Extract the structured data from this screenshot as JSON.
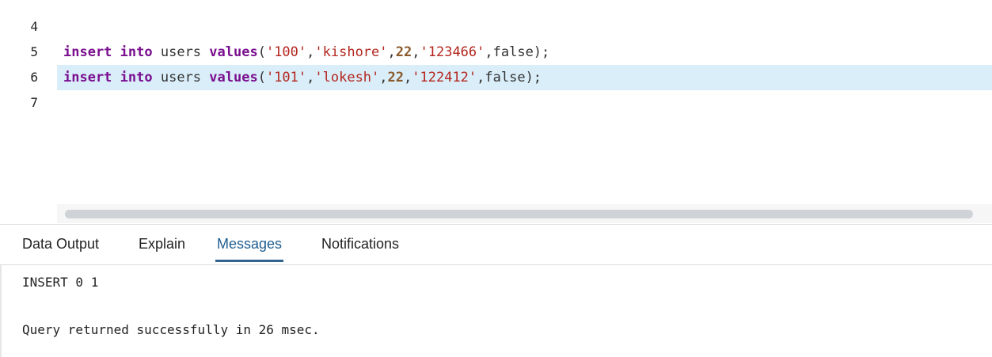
{
  "editor": {
    "lines": [
      {
        "number": "4",
        "tokens": []
      },
      {
        "number": "5",
        "tokens": [
          {
            "t": "kw",
            "v": "insert"
          },
          {
            "t": "plain",
            "v": " "
          },
          {
            "t": "kw",
            "v": "into"
          },
          {
            "t": "plain",
            "v": " users "
          },
          {
            "t": "kw",
            "v": "values"
          },
          {
            "t": "plain",
            "v": "("
          },
          {
            "t": "str",
            "v": "'100'"
          },
          {
            "t": "plain",
            "v": ","
          },
          {
            "t": "str",
            "v": "'kishore'"
          },
          {
            "t": "plain",
            "v": ","
          },
          {
            "t": "num",
            "v": "22"
          },
          {
            "t": "plain",
            "v": ","
          },
          {
            "t": "str",
            "v": "'123466'"
          },
          {
            "t": "plain",
            "v": ",false);"
          }
        ]
      },
      {
        "number": "6",
        "active": true,
        "tokens": [
          {
            "t": "kw",
            "v": "insert"
          },
          {
            "t": "plain",
            "v": " "
          },
          {
            "t": "kw",
            "v": "into"
          },
          {
            "t": "plain",
            "v": " users "
          },
          {
            "t": "kw",
            "v": "values"
          },
          {
            "t": "plain",
            "v": "("
          },
          {
            "t": "str",
            "v": "'101'"
          },
          {
            "t": "plain",
            "v": ","
          },
          {
            "t": "str",
            "v": "'lokesh'"
          },
          {
            "t": "plain",
            "v": ","
          },
          {
            "t": "num",
            "v": "22"
          },
          {
            "t": "plain",
            "v": ","
          },
          {
            "t": "str",
            "v": "'122412'"
          },
          {
            "t": "plain",
            "v": ",false);"
          }
        ]
      },
      {
        "number": "7",
        "tokens": []
      }
    ]
  },
  "tabs": {
    "data_output": "Data Output",
    "explain": "Explain",
    "messages": "Messages",
    "notifications": "Notifications"
  },
  "messages": {
    "line1": "INSERT 0 1",
    "line2": "Query returned successfully in 26 msec."
  },
  "colors": {
    "keyword": "#7a0f8f",
    "string": "#b3261e",
    "number": "#8a5a2b",
    "active_line": "#daeefa",
    "active_tab": "#326690"
  }
}
